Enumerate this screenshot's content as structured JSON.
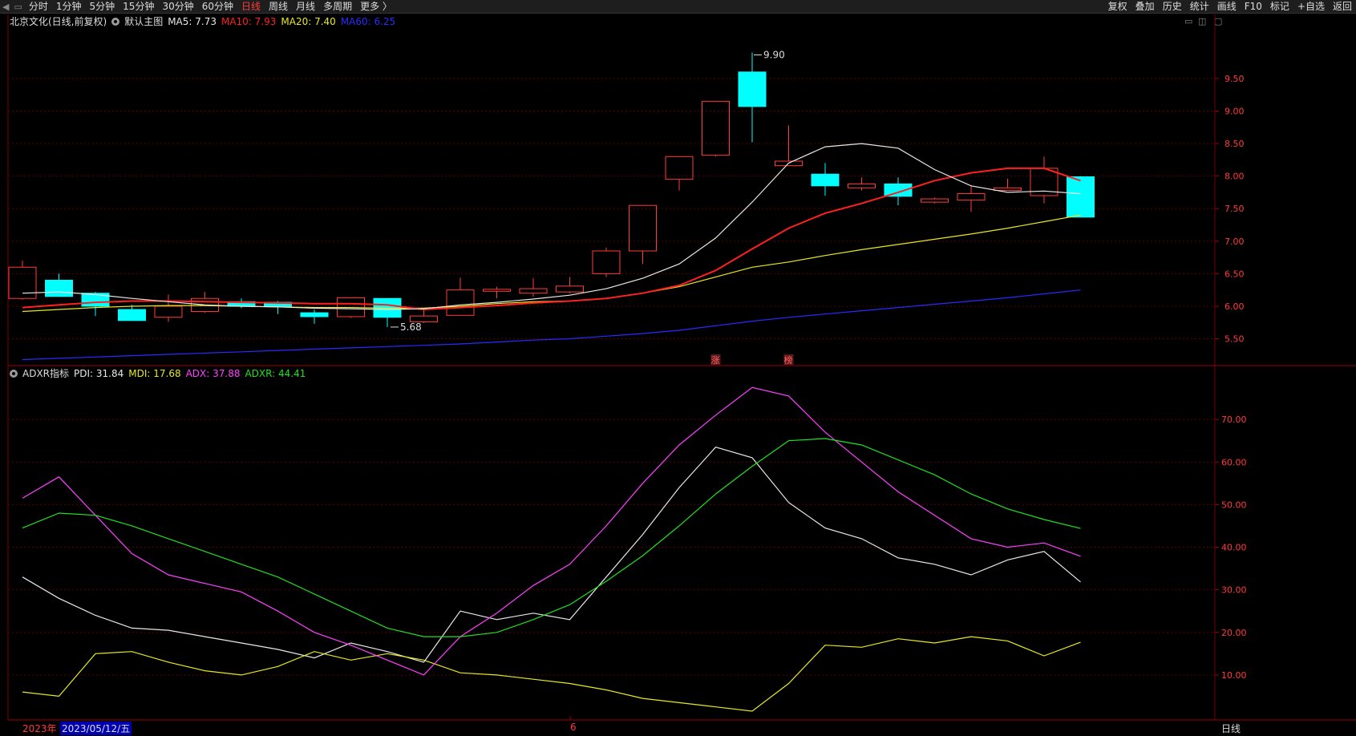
{
  "toolbar": {
    "left_items": [
      "分时",
      "1分钟",
      "5分钟",
      "15分钟",
      "30分钟",
      "60分钟",
      "日线",
      "周线",
      "月线",
      "多周期",
      "更多 〉"
    ],
    "active_index": 6,
    "right_items": [
      "复权",
      "叠加",
      "历史",
      "统计",
      "画线",
      "F10",
      "标记",
      "+自选",
      "返回"
    ]
  },
  "main_legend": {
    "stock": "北京文化(日线,前复权)",
    "template": "默认主图",
    "ma5": "MA5: 7.73",
    "ma10": "MA10: 7.93",
    "ma20": "MA20: 7.40",
    "ma60": "MA60: 6.25"
  },
  "sub_legend": {
    "name": "ADXR指标",
    "pdi": "PDI: 31.84",
    "mdi": "MDI: 17.68",
    "adx": "ADX: 37.88",
    "adxr": "ADXR: 44.41"
  },
  "markers": {
    "zhang": "涨",
    "bang": "榜"
  },
  "annotations": {
    "high": "9.90",
    "low": "5.68"
  },
  "status_bar": {
    "year": "2023年",
    "date": "2023/05/12/五",
    "month_mark": "6",
    "period": "日线"
  },
  "colors": {
    "up": "#ff3b3b",
    "down": "#00ffff",
    "ma5": "#e8e8e8",
    "ma10": "#ff2020",
    "ma20": "#e8e820",
    "ma60": "#2a2aff",
    "pdi": "#e8e8e8",
    "mdi": "#e8e820",
    "adx": "#ff40ff",
    "adxr": "#20e020",
    "grid": "#5a0000"
  },
  "chart_data": [
    {
      "type": "candlestick",
      "ylim": [
        5.1,
        10.3
      ],
      "yticks": [
        "5.50",
        "6.00",
        "6.50",
        "7.00",
        "7.50",
        "8.00",
        "8.50",
        "9.00",
        "9.50"
      ],
      "ytick_values": [
        5.5,
        6.0,
        6.5,
        7.0,
        7.5,
        8.0,
        8.5,
        9.0,
        9.5
      ],
      "candles": [
        {
          "o": 6.12,
          "h": 6.7,
          "l": 6.1,
          "c": 6.6
        },
        {
          "o": 6.4,
          "h": 6.5,
          "l": 6.15,
          "c": 6.15
        },
        {
          "o": 6.2,
          "h": 6.22,
          "l": 5.85,
          "c": 6.0
        },
        {
          "o": 5.95,
          "h": 6.02,
          "l": 5.78,
          "c": 5.78
        },
        {
          "o": 5.83,
          "h": 6.18,
          "l": 5.76,
          "c": 6.0
        },
        {
          "o": 5.92,
          "h": 6.22,
          "l": 5.9,
          "c": 6.12
        },
        {
          "o": 6.07,
          "h": 6.12,
          "l": 5.97,
          "c": 6.0
        },
        {
          "o": 6.06,
          "h": 6.08,
          "l": 5.88,
          "c": 6.0
        },
        {
          "o": 5.9,
          "h": 5.95,
          "l": 5.73,
          "c": 5.84
        },
        {
          "o": 5.84,
          "h": 6.13,
          "l": 5.82,
          "c": 6.13
        },
        {
          "o": 6.12,
          "h": 6.12,
          "l": 5.68,
          "c": 5.83
        },
        {
          "o": 5.76,
          "h": 5.96,
          "l": 5.74,
          "c": 5.85
        },
        {
          "o": 5.86,
          "h": 6.44,
          "l": 5.86,
          "c": 6.25
        },
        {
          "o": 6.23,
          "h": 6.3,
          "l": 6.12,
          "c": 6.26
        },
        {
          "o": 6.2,
          "h": 6.43,
          "l": 6.15,
          "c": 6.27
        },
        {
          "o": 6.22,
          "h": 6.45,
          "l": 6.2,
          "c": 6.31
        },
        {
          "o": 6.5,
          "h": 6.9,
          "l": 6.45,
          "c": 6.85
        },
        {
          "o": 6.85,
          "h": 7.55,
          "l": 6.65,
          "c": 7.55
        },
        {
          "o": 7.95,
          "h": 8.3,
          "l": 7.78,
          "c": 8.3
        },
        {
          "o": 8.32,
          "h": 9.15,
          "l": 8.3,
          "c": 9.15
        },
        {
          "o": 9.6,
          "h": 9.9,
          "l": 8.52,
          "c": 9.07
        },
        {
          "o": 8.16,
          "h": 8.78,
          "l": 8.16,
          "c": 8.23
        },
        {
          "o": 8.03,
          "h": 8.2,
          "l": 7.7,
          "c": 7.85
        },
        {
          "o": 7.82,
          "h": 7.98,
          "l": 7.78,
          "c": 7.88
        },
        {
          "o": 7.88,
          "h": 7.98,
          "l": 7.55,
          "c": 7.69
        },
        {
          "o": 7.6,
          "h": 7.67,
          "l": 7.58,
          "c": 7.65
        },
        {
          "o": 7.63,
          "h": 7.85,
          "l": 7.45,
          "c": 7.73
        },
        {
          "o": 7.78,
          "h": 7.96,
          "l": 7.78,
          "c": 7.82
        },
        {
          "o": 7.7,
          "h": 8.3,
          "l": 7.58,
          "c": 8.12
        },
        {
          "o": 7.99,
          "h": 8.0,
          "l": 7.37,
          "c": 7.37
        }
      ],
      "ma5": [
        6.2,
        6.22,
        6.18,
        6.12,
        6.07,
        6.02,
        6.0,
        5.99,
        5.97,
        5.96,
        5.95,
        5.96,
        6.02,
        6.06,
        6.11,
        6.17,
        6.27,
        6.43,
        6.65,
        7.05,
        7.6,
        8.2,
        8.45,
        8.5,
        8.43,
        8.1,
        7.85,
        7.75,
        7.77,
        7.73
      ],
      "ma10": [
        5.98,
        6.02,
        6.06,
        6.08,
        6.08,
        6.07,
        6.06,
        6.05,
        6.04,
        6.04,
        6.02,
        5.95,
        5.98,
        6.01,
        6.05,
        6.08,
        6.12,
        6.2,
        6.32,
        6.55,
        6.88,
        7.2,
        7.43,
        7.58,
        7.75,
        7.93,
        8.05,
        8.12,
        8.12,
        7.93
      ],
      "ma20": [
        5.92,
        5.95,
        5.98,
        6.0,
        6.01,
        6.01,
        6.0,
        5.99,
        5.98,
        5.98,
        5.97,
        5.97,
        6.0,
        6.04,
        6.07,
        6.08,
        6.12,
        6.2,
        6.3,
        6.45,
        6.6,
        6.68,
        6.78,
        6.87,
        6.95,
        7.03,
        7.11,
        7.2,
        7.3,
        7.4
      ],
      "ma60": [
        5.18,
        5.2,
        5.22,
        5.24,
        5.26,
        5.28,
        5.3,
        5.32,
        5.34,
        5.36,
        5.38,
        5.4,
        5.42,
        5.45,
        5.48,
        5.5,
        5.54,
        5.58,
        5.63,
        5.7,
        5.77,
        5.83,
        5.88,
        5.93,
        5.98,
        6.03,
        6.08,
        6.13,
        6.19,
        6.25
      ]
    },
    {
      "type": "line",
      "ylim": [
        0,
        80
      ],
      "yticks": [
        "10.00",
        "20.00",
        "30.00",
        "40.00",
        "50.00",
        "60.00",
        "70.00"
      ],
      "ytick_values": [
        10,
        20,
        30,
        40,
        50,
        60,
        70
      ],
      "series": [
        {
          "name": "PDI",
          "values": [
            33,
            28,
            24,
            21,
            20.5,
            19,
            17.5,
            16,
            14,
            17.5,
            15.5,
            13,
            25,
            23,
            24.5,
            23,
            33,
            43,
            54,
            63.5,
            61,
            50.5,
            44.5,
            42,
            37.5,
            36,
            33.5,
            37,
            39,
            31.84
          ]
        },
        {
          "name": "MDI",
          "values": [
            6,
            5,
            15,
            15.5,
            13,
            11,
            10,
            12,
            15.5,
            13.5,
            15,
            13.5,
            10.5,
            10,
            9,
            8,
            6.5,
            4.5,
            3.5,
            2.5,
            1.5,
            8,
            17,
            16.5,
            18.5,
            17.5,
            19,
            18,
            14.5,
            17.68
          ]
        },
        {
          "name": "ADX",
          "values": [
            51.5,
            56.5,
            47.5,
            38.5,
            33.5,
            31.5,
            29.5,
            25,
            20,
            17,
            13.5,
            10,
            19,
            24.5,
            31,
            36,
            45,
            55,
            64,
            71,
            77.5,
            75.5,
            67,
            60,
            53,
            47.5,
            42,
            40,
            41,
            37.88
          ]
        },
        {
          "name": "ADXR",
          "values": [
            44.5,
            48,
            47.5,
            45,
            42,
            39,
            36,
            33,
            29,
            25,
            21,
            19,
            19,
            20,
            23,
            26.5,
            32,
            38,
            45,
            52.5,
            59,
            65,
            65.5,
            64,
            60.5,
            57,
            52.5,
            49,
            46.5,
            44.41
          ]
        }
      ]
    }
  ]
}
